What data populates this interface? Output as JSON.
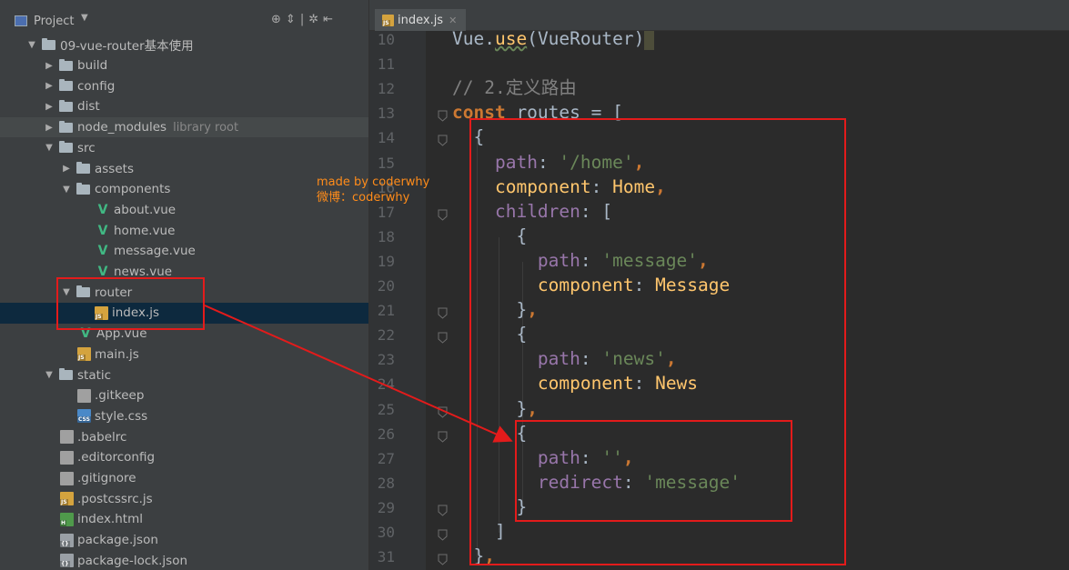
{
  "project_panel": {
    "title": "Project",
    "tree": [
      {
        "label": "09-vue-router基本使用",
        "kind": "folder",
        "depth": 0,
        "expanded": true
      },
      {
        "label": "build",
        "kind": "folder",
        "depth": 1,
        "expanded": false
      },
      {
        "label": "config",
        "kind": "folder",
        "depth": 1,
        "expanded": false
      },
      {
        "label": "dist",
        "kind": "folder",
        "depth": 1,
        "expanded": false
      },
      {
        "label": "node_modules",
        "kind": "folder",
        "depth": 1,
        "expanded": false,
        "suffix": "library root",
        "highlight": true
      },
      {
        "label": "src",
        "kind": "folder",
        "depth": 1,
        "expanded": true
      },
      {
        "label": "assets",
        "kind": "folder",
        "depth": 2,
        "expanded": false
      },
      {
        "label": "components",
        "kind": "folder",
        "depth": 2,
        "expanded": true
      },
      {
        "label": "about.vue",
        "kind": "vue",
        "depth": 3
      },
      {
        "label": "home.vue",
        "kind": "vue",
        "depth": 3
      },
      {
        "label": "message.vue",
        "kind": "vue",
        "depth": 3
      },
      {
        "label": "news.vue",
        "kind": "vue",
        "depth": 3
      },
      {
        "label": "router",
        "kind": "folder",
        "depth": 2,
        "expanded": true
      },
      {
        "label": "index.js",
        "kind": "js",
        "depth": 3,
        "selected": true
      },
      {
        "label": "App.vue",
        "kind": "vue",
        "depth": 2
      },
      {
        "label": "main.js",
        "kind": "js",
        "depth": 2
      },
      {
        "label": "static",
        "kind": "folder",
        "depth": 1,
        "expanded": true
      },
      {
        "label": ".gitkeep",
        "kind": "cfg",
        "depth": 2
      },
      {
        "label": "style.css",
        "kind": "css",
        "depth": 2
      },
      {
        "label": ".babelrc",
        "kind": "cfg",
        "depth": 1
      },
      {
        "label": ".editorconfig",
        "kind": "cfg",
        "depth": 1
      },
      {
        "label": ".gitignore",
        "kind": "cfg",
        "depth": 1
      },
      {
        "label": ".postcssrc.js",
        "kind": "js",
        "depth": 1
      },
      {
        "label": "index.html",
        "kind": "html",
        "depth": 1
      },
      {
        "label": "package.json",
        "kind": "json",
        "depth": 1
      },
      {
        "label": "package-lock.json",
        "kind": "json",
        "depth": 1
      }
    ]
  },
  "watermark": {
    "line1": "made by coderwhy",
    "line2": "微博：coderwhy"
  },
  "editor": {
    "tab_label": "index.js",
    "line_numbers": [
      "10",
      "11",
      "12",
      "13",
      "14",
      "15",
      "16",
      "17",
      "18",
      "19",
      "20",
      "21",
      "22",
      "23",
      "24",
      "25",
      "26",
      "27",
      "28",
      "29",
      "30",
      "31"
    ],
    "code_lines": [
      [
        {
          "t": "Vue.",
          "c": ""
        },
        {
          "t": "use",
          "c": "cls"
        },
        {
          "t": "(VueRouter)",
          "c": ""
        }
      ],
      [],
      [
        {
          "t": "// 2.定义路由",
          "c": "cmt"
        }
      ],
      [
        {
          "t": "const",
          "c": "kw"
        },
        {
          "t": " routes = [",
          "c": ""
        }
      ],
      [
        {
          "t": "  {",
          "c": ""
        }
      ],
      [
        {
          "t": "    ",
          "c": ""
        },
        {
          "t": "path",
          "c": "prop"
        },
        {
          "t": ": ",
          "c": ""
        },
        {
          "t": "'/home'",
          "c": "str"
        },
        {
          "t": ",",
          "c": "kw"
        }
      ],
      [
        {
          "t": "    ",
          "c": ""
        },
        {
          "t": "component",
          "c": "cls"
        },
        {
          "t": ": ",
          "c": ""
        },
        {
          "t": "Home",
          "c": "cls"
        },
        {
          "t": ",",
          "c": "kw"
        }
      ],
      [
        {
          "t": "    ",
          "c": ""
        },
        {
          "t": "children",
          "c": "prop"
        },
        {
          "t": ": [",
          "c": ""
        }
      ],
      [
        {
          "t": "      {",
          "c": ""
        }
      ],
      [
        {
          "t": "        ",
          "c": ""
        },
        {
          "t": "path",
          "c": "prop"
        },
        {
          "t": ": ",
          "c": ""
        },
        {
          "t": "'message'",
          "c": "str"
        },
        {
          "t": ",",
          "c": "kw"
        }
      ],
      [
        {
          "t": "        ",
          "c": ""
        },
        {
          "t": "component",
          "c": "cls"
        },
        {
          "t": ": ",
          "c": ""
        },
        {
          "t": "Message",
          "c": "cls"
        }
      ],
      [
        {
          "t": "      }",
          "c": ""
        },
        {
          "t": ",",
          "c": "kw"
        }
      ],
      [
        {
          "t": "      {",
          "c": ""
        }
      ],
      [
        {
          "t": "        ",
          "c": ""
        },
        {
          "t": "path",
          "c": "prop"
        },
        {
          "t": ": ",
          "c": ""
        },
        {
          "t": "'news'",
          "c": "str"
        },
        {
          "t": ",",
          "c": "kw"
        }
      ],
      [
        {
          "t": "        ",
          "c": ""
        },
        {
          "t": "component",
          "c": "cls"
        },
        {
          "t": ": ",
          "c": ""
        },
        {
          "t": "News",
          "c": "cls"
        }
      ],
      [
        {
          "t": "      }",
          "c": ""
        },
        {
          "t": ",",
          "c": "kw"
        }
      ],
      [
        {
          "t": "      {",
          "c": ""
        }
      ],
      [
        {
          "t": "        ",
          "c": ""
        },
        {
          "t": "path",
          "c": "prop"
        },
        {
          "t": ": ",
          "c": ""
        },
        {
          "t": "''",
          "c": "str"
        },
        {
          "t": ",",
          "c": "kw"
        }
      ],
      [
        {
          "t": "        ",
          "c": ""
        },
        {
          "t": "redirect",
          "c": "prop"
        },
        {
          "t": ": ",
          "c": ""
        },
        {
          "t": "'message'",
          "c": "str"
        }
      ],
      [
        {
          "t": "      }",
          "c": ""
        }
      ],
      [
        {
          "t": "    ]",
          "c": ""
        }
      ],
      [
        {
          "t": "  }",
          "c": ""
        },
        {
          "t": ",",
          "c": "kw"
        }
      ]
    ]
  },
  "colors": {
    "annotation_red": "#e31b1b",
    "watermark_orange": "#ff8c1a",
    "keyword": "#cc7832",
    "property": "#9876aa",
    "string": "#6a8759"
  }
}
